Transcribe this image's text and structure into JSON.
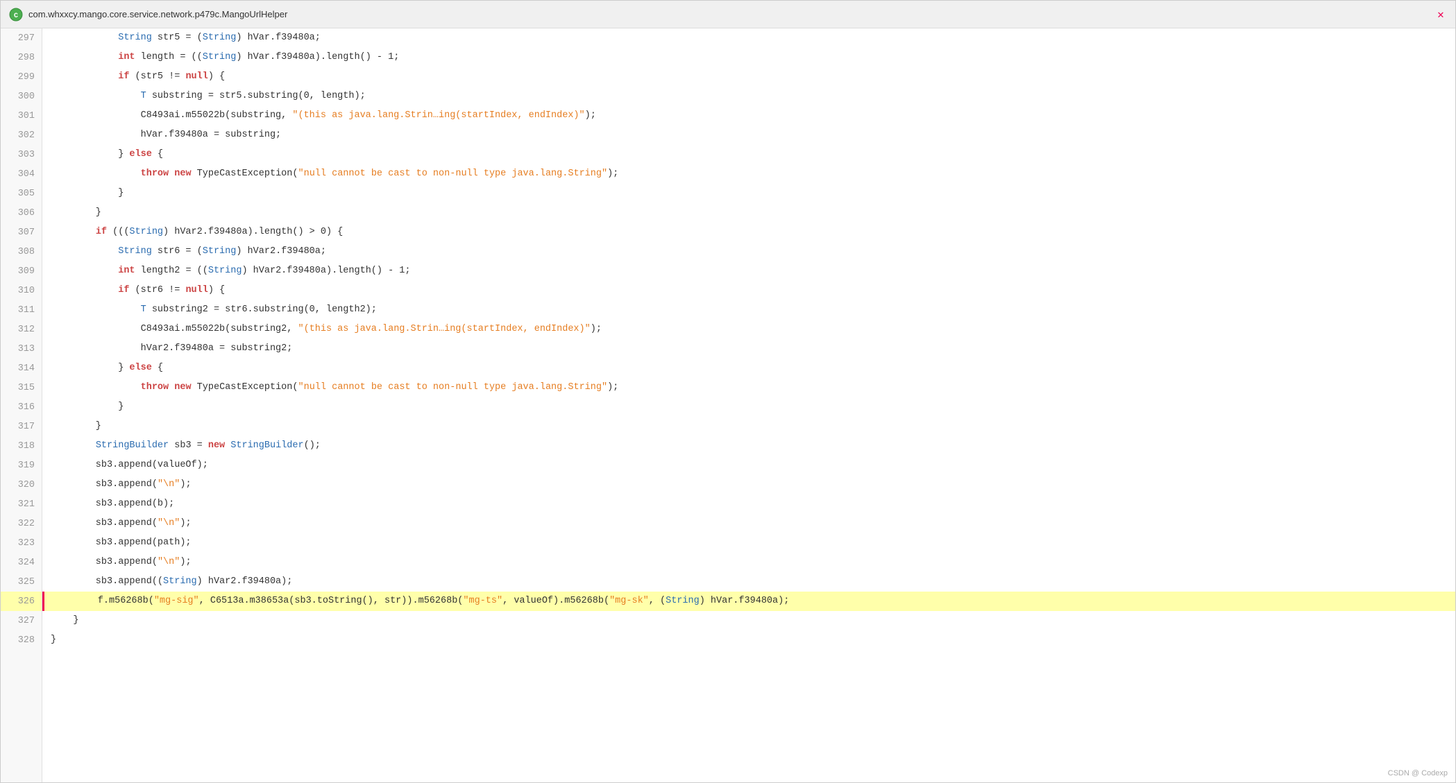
{
  "titleBar": {
    "title": "com.whxxcy.mango.core.service.network.p479c.MangoUrlHelper",
    "closeLabel": "✕"
  },
  "lines": [
    {
      "num": 297,
      "highlight": false,
      "active": false,
      "content": "line_297"
    },
    {
      "num": 298,
      "highlight": false,
      "active": false,
      "content": "line_298"
    },
    {
      "num": 299,
      "highlight": false,
      "active": false,
      "content": "line_299"
    },
    {
      "num": 300,
      "highlight": false,
      "active": false,
      "content": "line_300"
    },
    {
      "num": 301,
      "highlight": false,
      "active": false,
      "content": "line_301"
    },
    {
      "num": 302,
      "highlight": false,
      "active": false,
      "content": "line_302"
    },
    {
      "num": 303,
      "highlight": false,
      "active": false,
      "content": "line_303"
    },
    {
      "num": 304,
      "highlight": false,
      "active": false,
      "content": "line_304"
    },
    {
      "num": 305,
      "highlight": false,
      "active": false,
      "content": "line_305"
    },
    {
      "num": 306,
      "highlight": false,
      "active": false,
      "content": "line_306"
    },
    {
      "num": 307,
      "highlight": false,
      "active": false,
      "content": "line_307"
    },
    {
      "num": 308,
      "highlight": false,
      "active": false,
      "content": "line_308"
    },
    {
      "num": 309,
      "highlight": false,
      "active": false,
      "content": "line_309"
    },
    {
      "num": 310,
      "highlight": false,
      "active": false,
      "content": "line_310"
    },
    {
      "num": 311,
      "highlight": false,
      "active": false,
      "content": "line_311"
    },
    {
      "num": 312,
      "highlight": false,
      "active": false,
      "content": "line_312"
    },
    {
      "num": 313,
      "highlight": false,
      "active": false,
      "content": "line_313"
    },
    {
      "num": 314,
      "highlight": false,
      "active": false,
      "content": "line_314"
    },
    {
      "num": 315,
      "highlight": false,
      "active": false,
      "content": "line_315"
    },
    {
      "num": 316,
      "highlight": false,
      "active": false,
      "content": "line_316"
    },
    {
      "num": 317,
      "highlight": false,
      "active": false,
      "content": "line_317"
    },
    {
      "num": 318,
      "highlight": false,
      "active": false,
      "content": "line_318"
    },
    {
      "num": 319,
      "highlight": false,
      "active": false,
      "content": "line_319"
    },
    {
      "num": 320,
      "highlight": false,
      "active": false,
      "content": "line_320"
    },
    {
      "num": 321,
      "highlight": false,
      "active": false,
      "content": "line_321"
    },
    {
      "num": 322,
      "highlight": false,
      "active": false,
      "content": "line_322"
    },
    {
      "num": 323,
      "highlight": false,
      "active": false,
      "content": "line_323"
    },
    {
      "num": 324,
      "highlight": false,
      "active": false,
      "content": "line_324"
    },
    {
      "num": 325,
      "highlight": false,
      "active": false,
      "content": "line_325"
    },
    {
      "num": 326,
      "highlight": true,
      "active": true,
      "content": "line_326"
    },
    {
      "num": 327,
      "highlight": false,
      "active": false,
      "content": "line_327"
    },
    {
      "num": 328,
      "highlight": false,
      "active": false,
      "content": "line_328"
    }
  ],
  "watermark": "CSDN @ Codexp"
}
